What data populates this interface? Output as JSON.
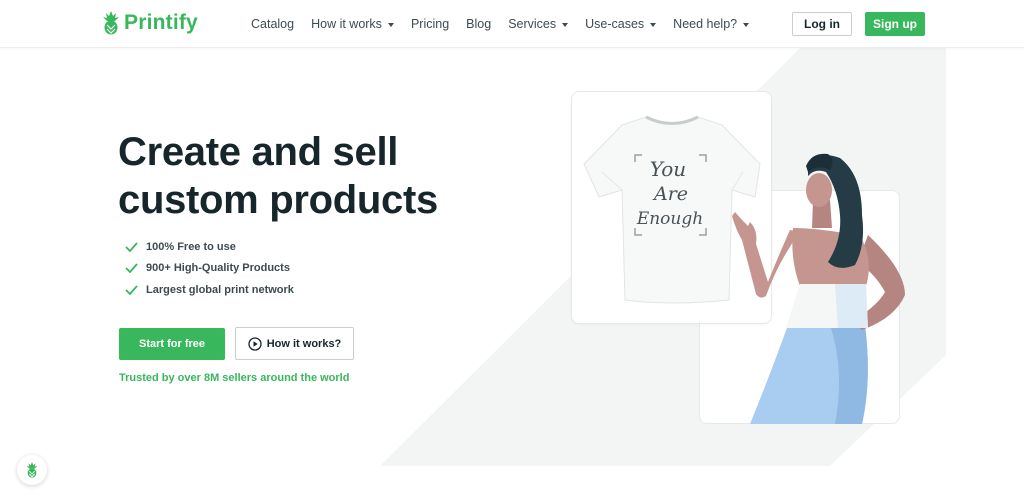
{
  "header": {
    "logo_text": "Printify",
    "nav": [
      {
        "label": "Catalog",
        "dropdown": false
      },
      {
        "label": "How it works",
        "dropdown": true
      },
      {
        "label": "Pricing",
        "dropdown": false
      },
      {
        "label": "Blog",
        "dropdown": false
      },
      {
        "label": "Services",
        "dropdown": true
      },
      {
        "label": "Use-cases",
        "dropdown": true
      },
      {
        "label": "Need help?",
        "dropdown": true
      }
    ],
    "login_label": "Log in",
    "signup_label": "Sign up"
  },
  "hero": {
    "headline_line1": "Create and sell",
    "headline_line2": "custom products",
    "features": [
      "100% Free to use",
      "900+ High-Quality Products",
      "Largest global print network"
    ],
    "cta_primary": "Start for free",
    "cta_secondary": "How it works?",
    "trusted_text": "Trusted by over 8M sellers around the world"
  },
  "illustration": {
    "shirt_print_lines": [
      "You",
      "Are",
      "Enough"
    ]
  },
  "colors": {
    "brand_green": "#39b75d",
    "text_dark": "#17262b",
    "bg_shape": "#f3f4f4"
  },
  "icons": {
    "logo": "pineapple-logo-icon",
    "feature": "checkmark-icon",
    "how_it_works": "play-circle-icon",
    "chat": "pineapple-chat-icon"
  }
}
